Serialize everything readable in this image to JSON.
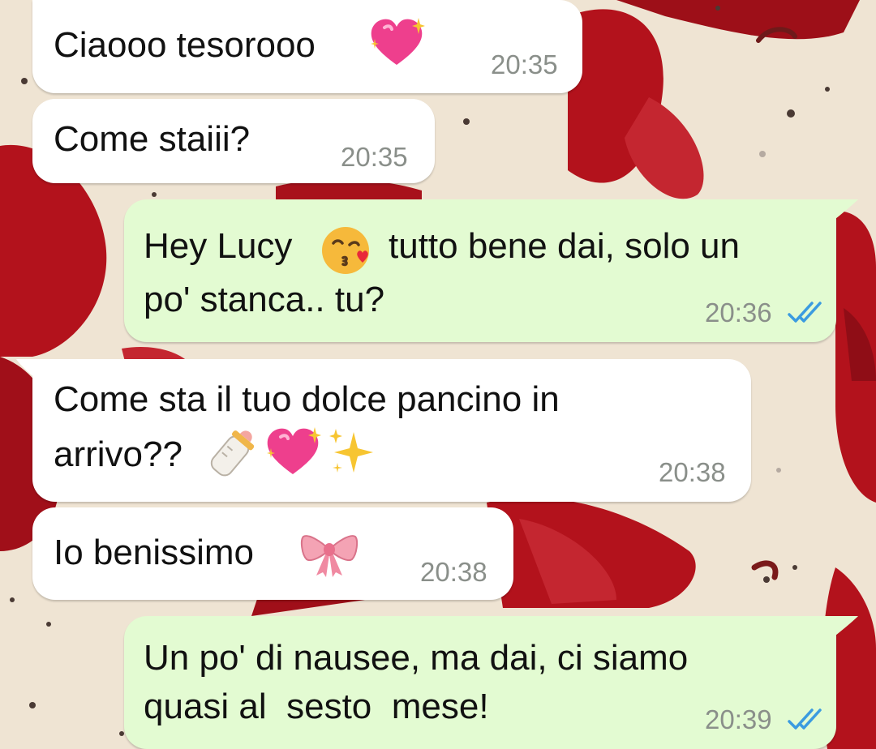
{
  "messages": [
    {
      "direction": "incoming",
      "text": "Ciaooo tesorooo",
      "emojis": [
        "sparkling-heart"
      ],
      "time": "20:35"
    },
    {
      "direction": "incoming",
      "text": "Come staiii?",
      "time": "20:35"
    },
    {
      "direction": "outgoing",
      "line1_a": "Hey Lucy",
      "line1_b": "tutto bene dai, solo un",
      "line2": "po' stanca.. tu?",
      "emojis": [
        "face-blowing-kiss"
      ],
      "time": "20:36",
      "status": "read"
    },
    {
      "direction": "incoming",
      "line1": "Come sta il tuo dolce pancino in",
      "line2": "arrivo??",
      "emojis": [
        "baby-bottle",
        "sparkling-heart",
        "sparkles"
      ],
      "time": "20:38"
    },
    {
      "direction": "incoming",
      "text": "Io benissimo",
      "emojis": [
        "ribbon"
      ],
      "time": "20:38"
    },
    {
      "direction": "outgoing",
      "line1": "Un po' di nausee, ma dai, ci siamo",
      "line2": "quasi al  sesto  mese!",
      "time": "20:39",
      "status": "read"
    }
  ],
  "colors": {
    "incoming_bubble": "#ffffff",
    "outgoing_bubble": "#e3fbd2",
    "timestamp": "#8a8f8a",
    "read_ticks": "#3b9be0",
    "wallpaper_bg": "#efe4d3",
    "wallpaper_bow": "#b3121c"
  }
}
